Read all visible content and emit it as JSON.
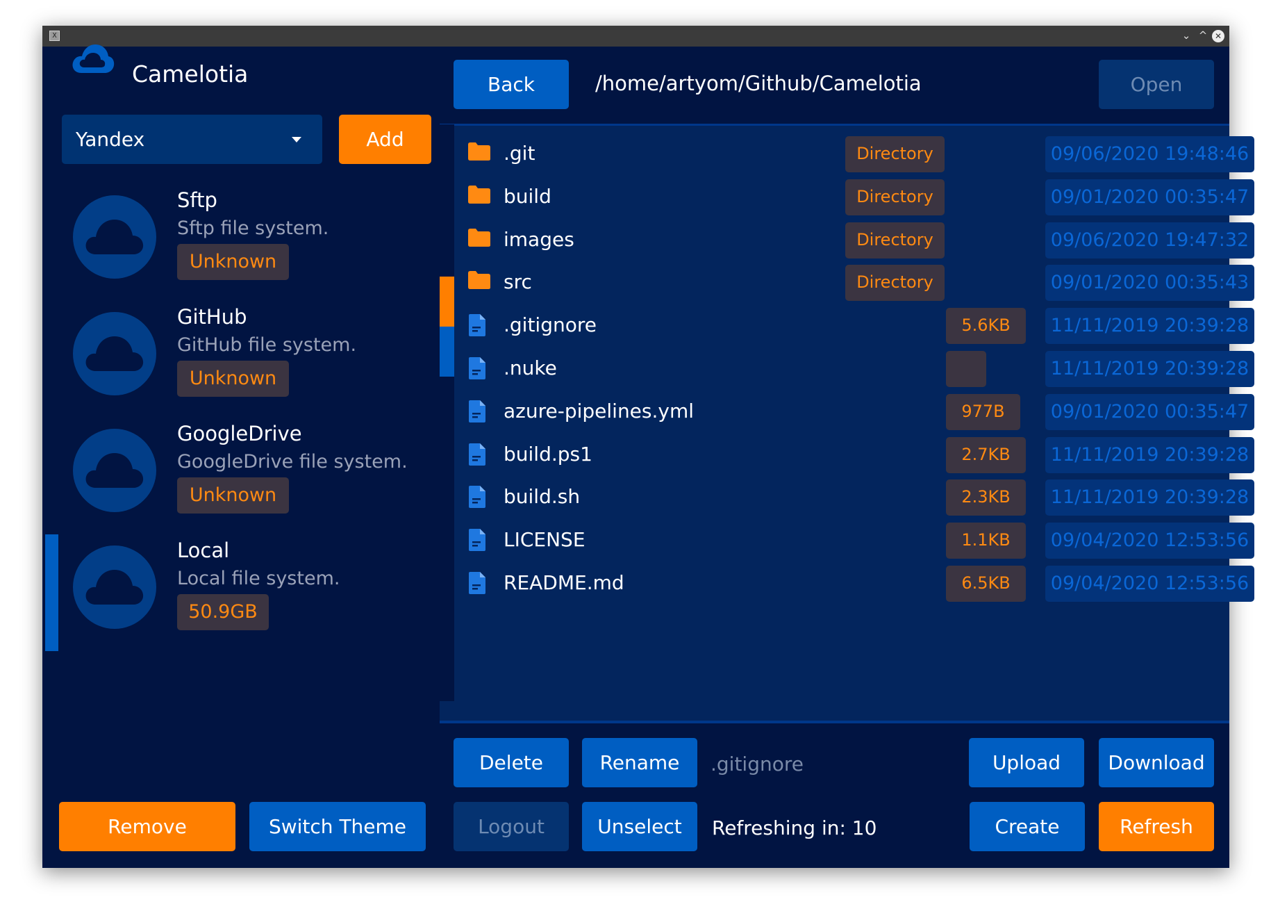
{
  "window": {
    "app_icon_glyph": "X",
    "controls": {
      "minimize_glyph": "⌄",
      "maximize_glyph": "^",
      "close_glyph": "✕"
    }
  },
  "sidebar": {
    "app_title": "Camelotia",
    "logo_icon": "cloud-icon",
    "provider_select": {
      "value": "Yandex"
    },
    "add_label": "Add",
    "providers": [
      {
        "name": "Sftp",
        "description": "Sftp file system.",
        "badge": "Unknown",
        "selected": false
      },
      {
        "name": "GitHub",
        "description": "GitHub file system.",
        "badge": "Unknown",
        "selected": false
      },
      {
        "name": "GoogleDrive",
        "description": "GoogleDrive file system.",
        "badge": "Unknown",
        "selected": false
      },
      {
        "name": "Local",
        "description": "Local file system.",
        "badge": "50.9GB",
        "selected": true
      }
    ],
    "remove_label": "Remove",
    "switch_theme_label": "Switch Theme"
  },
  "browser": {
    "back_label": "Back",
    "path": "/home/artyom/Github/Camelotia",
    "open_label": "Open",
    "files": [
      {
        "name": ".git",
        "icon": "folder-icon",
        "kind": "Directory",
        "modified": "09/06/2020 19:48:46"
      },
      {
        "name": "build",
        "icon": "folder-icon",
        "kind": "Directory",
        "modified": "09/01/2020 00:35:47"
      },
      {
        "name": "images",
        "icon": "folder-icon",
        "kind": "Directory",
        "modified": "09/06/2020 19:47:32"
      },
      {
        "name": "src",
        "icon": "folder-icon",
        "kind": "Directory",
        "modified": "09/01/2020 00:35:43"
      },
      {
        "name": ".gitignore",
        "icon": "file-icon",
        "kind": "5.6KB",
        "modified": "11/11/2019 20:39:28"
      },
      {
        "name": ".nuke",
        "icon": "file-icon",
        "kind": "",
        "modified": "11/11/2019 20:39:28"
      },
      {
        "name": "azure-pipelines.yml",
        "icon": "file-icon",
        "kind": "977B",
        "modified": "09/01/2020 00:35:47"
      },
      {
        "name": "build.ps1",
        "icon": "file-icon",
        "kind": "2.7KB",
        "modified": "11/11/2019 20:39:28"
      },
      {
        "name": "build.sh",
        "icon": "file-icon",
        "kind": "2.3KB",
        "modified": "11/11/2019 20:39:28"
      },
      {
        "name": "LICENSE",
        "icon": "file-icon",
        "kind": "1.1KB",
        "modified": "09/04/2020 12:53:56"
      },
      {
        "name": "README.md",
        "icon": "file-icon",
        "kind": "6.5KB",
        "modified": "09/04/2020 12:53:56"
      }
    ],
    "actions": {
      "delete_label": "Delete",
      "rename_label": "Rename",
      "selected_path": ".gitignore",
      "upload_label": "Upload",
      "download_label": "Download",
      "logout_label": "Logout",
      "unselect_label": "Unselect",
      "refresh_status": "Refreshing in: 10",
      "create_label": "Create",
      "refresh_label": "Refresh"
    }
  },
  "colors": {
    "background": "#011442",
    "accent_blue": "#005ec2",
    "accent_orange": "#ff7f00",
    "badge_bg": "#3b3441",
    "badge_text": "#ff8a12",
    "date_bg": "#03337a",
    "date_text": "#0b67d6"
  }
}
